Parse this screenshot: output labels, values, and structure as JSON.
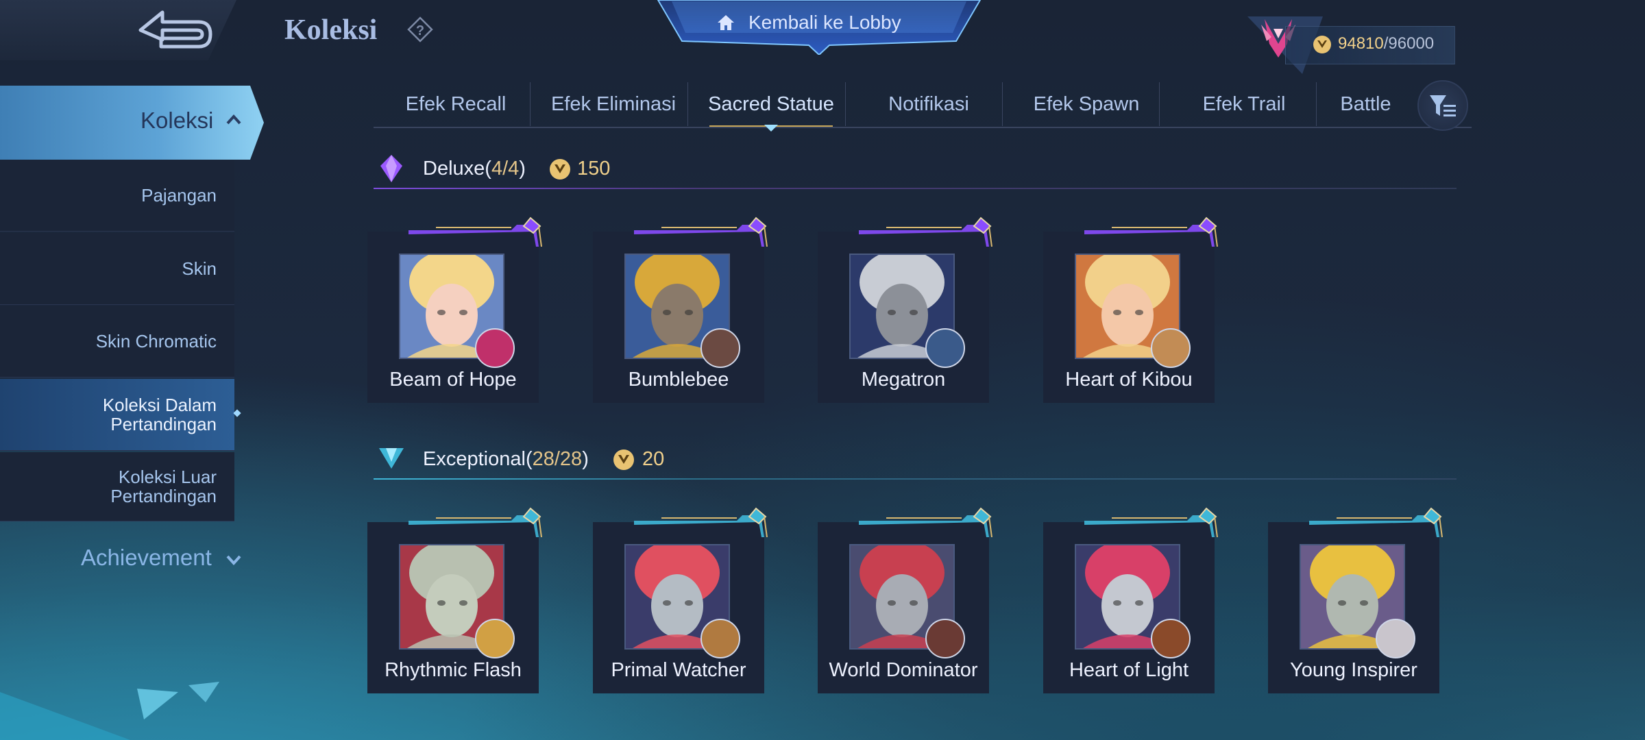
{
  "header": {
    "title": "Koleksi",
    "help_icon": "question-icon",
    "back_icon": "back-arrow-icon",
    "lobby_label": "Kembali ke Lobby",
    "lobby_icon": "home-icon",
    "currency_current": "94810",
    "currency_max": "/96000",
    "currency_icon": "mastery-coin-icon"
  },
  "sidebar": {
    "active_label": "Koleksi",
    "items": [
      {
        "line1": "Pajangan",
        "line2": ""
      },
      {
        "line1": "Skin",
        "line2": ""
      },
      {
        "line1": "Skin Chromatic",
        "line2": ""
      },
      {
        "line1": "Koleksi Dalam",
        "line2": "Pertandingan"
      },
      {
        "line1": "Koleksi Luar",
        "line2": "Pertandingan"
      }
    ],
    "achievement_label": "Achievement"
  },
  "tabs": [
    "Efek Recall",
    "Efek Eliminasi",
    "Sacred Statue",
    "Notifikasi",
    "Efek Spawn",
    "Efek Trail",
    "Battle"
  ],
  "active_tab": "Sacred Statue",
  "sections": {
    "deluxe": {
      "name": "Deluxe",
      "open": "(",
      "count": "4/4",
      "close": ")",
      "price": "150",
      "accent": "#8a4cff",
      "items": [
        {
          "name": "Beam of Hope",
          "hero_color": "#c0306a",
          "art": "blonde-girl"
        },
        {
          "name": "Bumblebee",
          "hero_color": "#6b4a42",
          "art": "yellow-robot"
        },
        {
          "name": "Megatron",
          "hero_color": "#3a5a8a",
          "art": "grey-robot"
        },
        {
          "name": "Heart of Kibou",
          "hero_color": "#c28c55",
          "art": "blonde-girl-2"
        }
      ]
    },
    "exceptional": {
      "name": "Exceptional",
      "open": "(",
      "count": "28/28",
      "close": ")",
      "price": "20",
      "accent": "#3fb7d8",
      "items": [
        {
          "name": "Rhythmic Flash",
          "hero_color": "#d1a044",
          "art": "stone-girl"
        },
        {
          "name": "Primal Watcher",
          "hero_color": "#b07a40",
          "art": "stone-queen"
        },
        {
          "name": "World Dominator",
          "hero_color": "#6a3a34",
          "art": "stone-demon"
        },
        {
          "name": "Heart of Light",
          "hero_color": "#8a4a2a",
          "art": "stone-lady"
        },
        {
          "name": "Young Inspirer",
          "hero_color": "#c9c5cc",
          "art": "stone-boy"
        }
      ]
    }
  }
}
